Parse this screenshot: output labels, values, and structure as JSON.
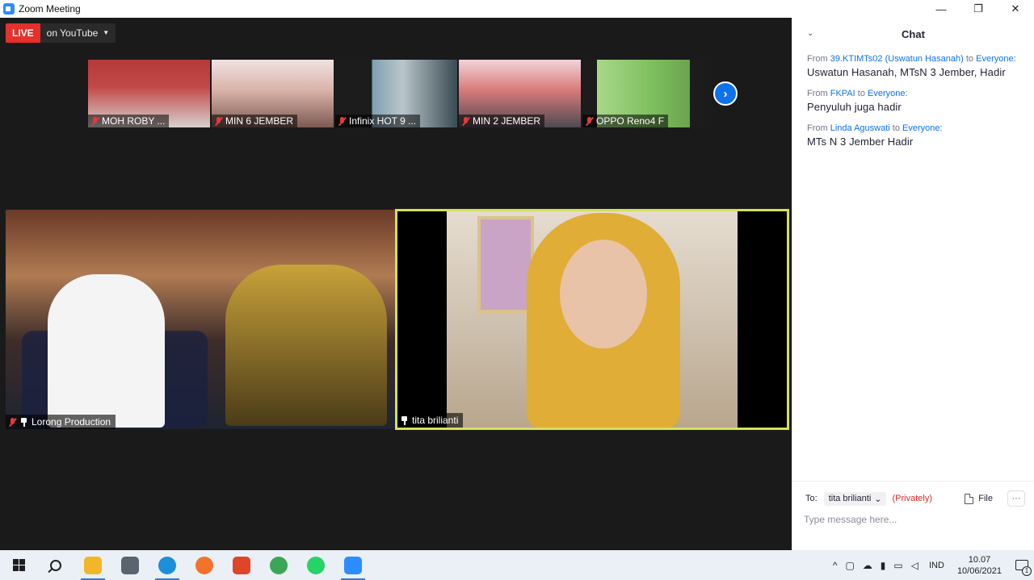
{
  "window": {
    "title": "Zoom Meeting",
    "minimize": "—",
    "maximize": "❐",
    "close": "✕"
  },
  "live": {
    "badge": "LIVE",
    "destination": "on YouTube",
    "caret": "▼"
  },
  "thumbnails": [
    {
      "name": "MOH ROBY ..."
    },
    {
      "name": "MIN 6 JEMBER"
    },
    {
      "name": "Infinix HOT 9 ..."
    },
    {
      "name": "MIN 2 JEMBER"
    },
    {
      "name": "OPPO Reno4 F"
    }
  ],
  "next_page_glyph": "›",
  "main_videos": [
    {
      "name": "Lorong Production"
    },
    {
      "name": "tita brilianti"
    }
  ],
  "chat": {
    "collapse_glyph": "⌄",
    "title": "Chat",
    "messages": [
      {
        "from_label": "From",
        "sender": "39.KTIMTs02 (Uswatun Hasanah)",
        "to_label": "to",
        "recipient": "Everyone:",
        "text": "Uswatun Hasanah, MTsN 3 Jember, Hadir"
      },
      {
        "from_label": "From",
        "sender": "FKPAI",
        "to_label": "to",
        "recipient": "Everyone:",
        "text": "Penyuluh juga hadir"
      },
      {
        "from_label": "From",
        "sender": "Linda Aguswati",
        "to_label": "to",
        "recipient": "Everyone:",
        "text": "MTs N 3 Jember Hadir"
      }
    ],
    "to_label": "To:",
    "recipient": "tita brilianti",
    "recipient_caret": "⌄",
    "privately": "(Privately)",
    "file_label": "File",
    "more_glyph": "···",
    "input_placeholder": "Type message here..."
  },
  "taskbar": {
    "tray_chevron": "^",
    "language": "IND",
    "time": "10.07",
    "date": "10/06/2021",
    "notification_count": "1",
    "app_colors": {
      "file-explorer": "#f2b729",
      "camera": "#5a6470",
      "edge": "#1d8fd8",
      "firefox": "#f3732d",
      "pdf-app": "#e0452a",
      "chrome": "#3aa757",
      "whatsapp": "#25d366",
      "zoom": "#2d8cff"
    }
  }
}
